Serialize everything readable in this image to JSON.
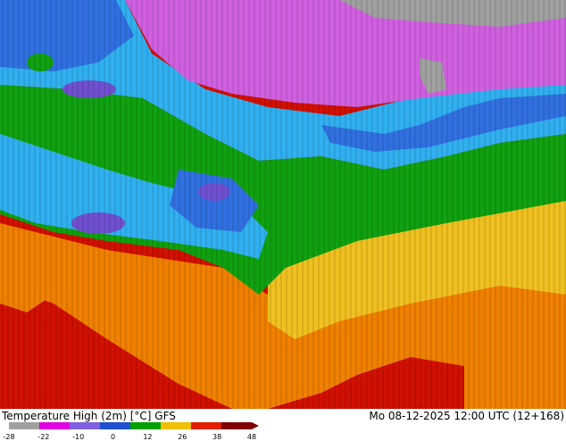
{
  "header": {
    "title": "Temperature High (2m) [°C] GFS",
    "datetime": "Mo 08-12-2025 12:00 UTC (12+168)"
  },
  "legend": {
    "ticks": [
      "-28",
      "-22",
      "-10",
      "0",
      "12",
      "26",
      "38",
      "48"
    ],
    "colors": [
      "#a0a0a0",
      "#e000e0",
      "#8060e0",
      "#2050d0",
      "#00a000",
      "#f0c000",
      "#e02000",
      "#800000"
    ]
  },
  "map": {
    "colors": {
      "very_cold": "#a0a0a0",
      "cold_magenta": "#d060e0",
      "cold_purple": "#7050d0",
      "cold_blue": "#3070e0",
      "cool_cyan": "#30b0f0",
      "mild_green": "#10a010",
      "warm_yellow": "#f0c020",
      "hot_orange": "#f08000",
      "very_hot_red": "#d01000"
    }
  }
}
